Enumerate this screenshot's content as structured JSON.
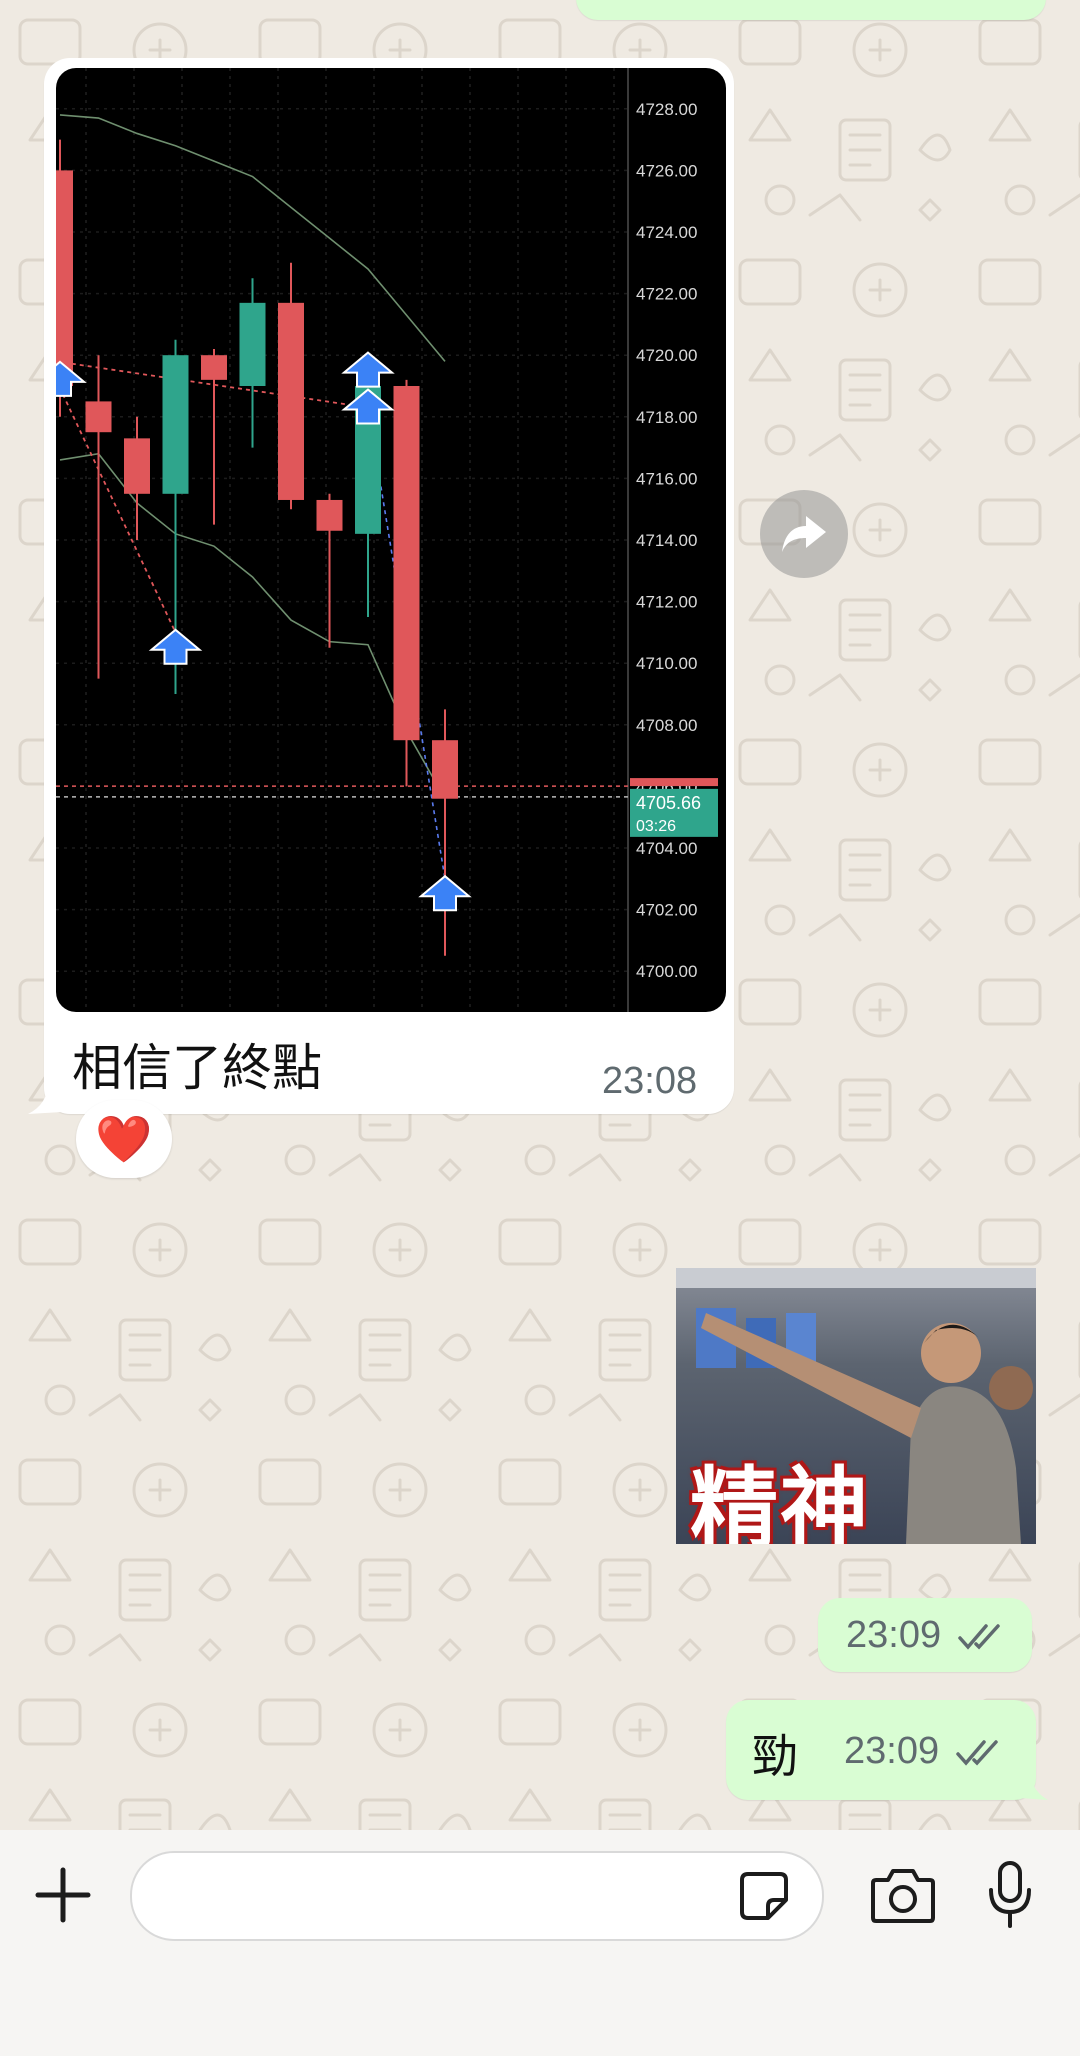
{
  "messages": {
    "incoming": {
      "caption": "相信了終點",
      "time": "23:08",
      "reaction": "❤️"
    },
    "sticker": {
      "text": "精神",
      "time": "23:09"
    },
    "outgoing_text": {
      "text": "勁",
      "time": "23:09"
    }
  },
  "chart_data": {
    "type": "candlestick",
    "price_axis": [
      "4728.00",
      "4726.00",
      "4724.00",
      "4722.00",
      "4720.00",
      "4718.00",
      "4716.00",
      "4714.00",
      "4712.00",
      "4710.00",
      "4708.00",
      "4706.00",
      "4704.00",
      "4702.00",
      "4700.00"
    ],
    "current_price": "4705.66",
    "countdown": "03:26",
    "ylim": [
      4699,
      4729
    ],
    "candles": [
      {
        "open": 4726.0,
        "close": 4719.0,
        "high": 4727.0,
        "low": 4718.0,
        "color": "red"
      },
      {
        "open": 4718.5,
        "close": 4717.5,
        "high": 4720.0,
        "low": 4709.5,
        "color": "red"
      },
      {
        "open": 4717.3,
        "close": 4715.5,
        "high": 4718.0,
        "low": 4714.0,
        "color": "red"
      },
      {
        "open": 4715.5,
        "close": 4720.0,
        "high": 4720.5,
        "low": 4709.0,
        "color": "green"
      },
      {
        "open": 4720.0,
        "close": 4719.2,
        "high": 4720.2,
        "low": 4714.5,
        "color": "red"
      },
      {
        "open": 4719.0,
        "close": 4721.7,
        "high": 4722.5,
        "low": 4717.0,
        "color": "green"
      },
      {
        "open": 4721.7,
        "close": 4715.3,
        "high": 4723.0,
        "low": 4715.0,
        "color": "red"
      },
      {
        "open": 4715.3,
        "close": 4714.3,
        "high": 4715.5,
        "low": 4710.5,
        "color": "red"
      },
      {
        "open": 4714.2,
        "close": 4719.0,
        "high": 4720.0,
        "low": 4711.5,
        "color": "green"
      },
      {
        "open": 4719.0,
        "close": 4707.5,
        "high": 4719.2,
        "low": 4706.0,
        "color": "red"
      },
      {
        "open": 4707.5,
        "close": 4705.6,
        "high": 4708.5,
        "low": 4700.5,
        "color": "red"
      }
    ],
    "ma_upper": [
      4727.8,
      4727.7,
      4727.2,
      4726.8,
      4726.3,
      4725.8,
      4724.8,
      4723.8,
      4722.8,
      4721.3,
      4719.8
    ],
    "ma_lower": [
      4716.6,
      4716.8,
      4715.2,
      4714.2,
      4713.8,
      4712.8,
      4711.4,
      4710.7,
      4710.6,
      4707.8,
      4705.6
    ],
    "arrows_up": [
      {
        "i": 0,
        "price": 4719.2
      },
      {
        "i": 3,
        "price": 4710.5
      },
      {
        "i": 8,
        "price": 4719.5
      },
      {
        "i": 8,
        "price": 4718.3
      },
      {
        "i": 10,
        "price": 4702.5
      }
    ]
  },
  "colors": {
    "chat_bg": "#efeae2",
    "out_bubble": "#d9fdd3",
    "in_bubble": "#ffffff",
    "candle_red": "#e0575a",
    "candle_green": "#2fa58c",
    "arrow_blue": "#3b82f6",
    "read_ticks": "#5f6a6f"
  },
  "composer": {
    "icons": [
      "plus-icon",
      "sticker-icon",
      "camera-icon",
      "microphone-icon"
    ]
  }
}
